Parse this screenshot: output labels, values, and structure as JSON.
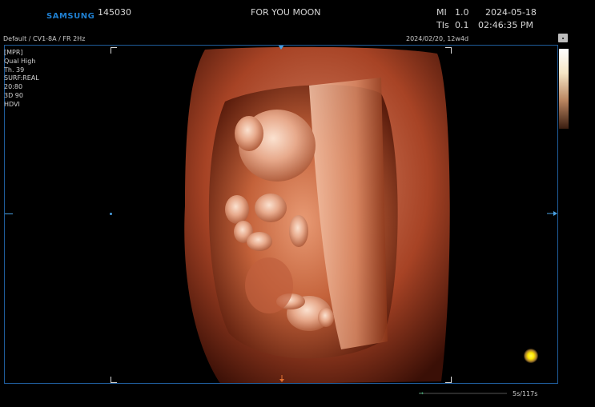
{
  "header": {
    "brand": "SAMSUNG",
    "patient_id": "145030",
    "patient_name": "FOR YOU MOON",
    "mi_label": "MI",
    "mi_value": "1.0",
    "tis_label": "TIs",
    "tis_value": "0.1",
    "date": "2024-05-18",
    "time": "02:46:35 PM"
  },
  "preset": {
    "probe_info": "Default / CV1-8A / FR 2Hz",
    "exam_info": "2024/02/20, 12w4d"
  },
  "params": [
    "[MPR]",
    "Qual High",
    "Th. 39",
    "SURF:REAL",
    "20:80",
    "3D 90",
    "HDVI"
  ],
  "footer": {
    "cine_info": "5s/117s"
  },
  "colors": {
    "brand": "#1f7fd0",
    "frame_border": "#1f5c9a",
    "marker": "#4aa0e0",
    "orange_marker": "#e07030",
    "render_base": "#b0502e",
    "cursor": "#ffe600"
  },
  "icons": {
    "top_marker": "triangle-down-icon",
    "bottom_marker": "arrow-down-icon",
    "right_marker": "arrow-right-icon",
    "cursor": "trackball-cursor-icon"
  }
}
